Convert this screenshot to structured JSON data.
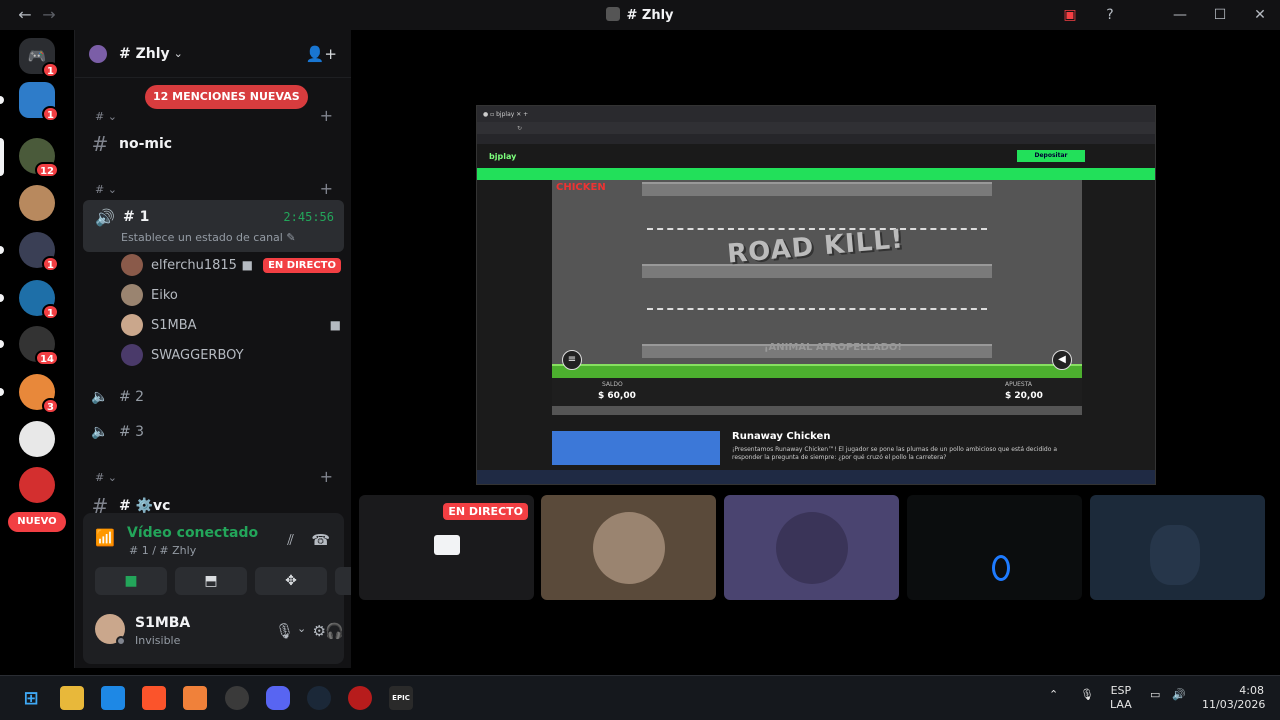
{
  "window": {
    "title": "# Zhly"
  },
  "server_badges": [
    "1",
    "1",
    "12",
    "1",
    "1",
    "14",
    "3"
  ],
  "nuevo_label": "NUEVO",
  "guild": {
    "name": "# Zhly",
    "mentions_pill": "12 MENCIONES NUEVAS"
  },
  "categories": {
    "cat1": "# ⌄",
    "cat2": "# ⌄",
    "cat3": "# ⌄"
  },
  "channels": {
    "text1": "no-mic",
    "voice_active": {
      "name": "# 1",
      "timer": "2:45:56",
      "status": "Establece un estado de canal"
    },
    "voice2": "# 2",
    "voice3": "# 3",
    "text2": "# ⚙️vc"
  },
  "members": [
    {
      "name": "elferchu1815",
      "live": "EN DIRECTO"
    },
    {
      "name": "Eiko"
    },
    {
      "name": "S1MBA"
    },
    {
      "name": "SWAGGERBOY"
    }
  ],
  "voice_panel": {
    "title": "Vídeo conectado",
    "subtitle": "# 1 / # Zhly"
  },
  "user": {
    "name": "S1MBA",
    "status": "Invisible"
  },
  "share": {
    "brand": "bjplay",
    "deposit": "Depositar",
    "game_logo": "CHICKEN",
    "road_kill": "ROAD KILL!",
    "animal_text": "¡ANIMAL ATROPELLADO!",
    "saldo_label": "SALDO",
    "saldo_value": "$ 60,00",
    "apuesta_label": "APUESTA",
    "apuesta_value": "$ 20,00",
    "promo_title": "Runaway Chicken",
    "promo_desc": "¡Presentamos Runaway Chicken™! El jugador se pone las plumas de un pollo ambicioso que está decidido a responder la pregunta de siempre: ¿por qué cruzó el pollo la carretera?"
  },
  "tiles": {
    "live": "EN DIRECTO"
  },
  "tray": {
    "lang": "ESP",
    "layout": "LAA",
    "time": "4:08",
    "date": "11/03/2026"
  },
  "colors": {
    "accent_green": "#23a55a",
    "live_red": "#f23f43",
    "blurple": "#5865f2"
  }
}
